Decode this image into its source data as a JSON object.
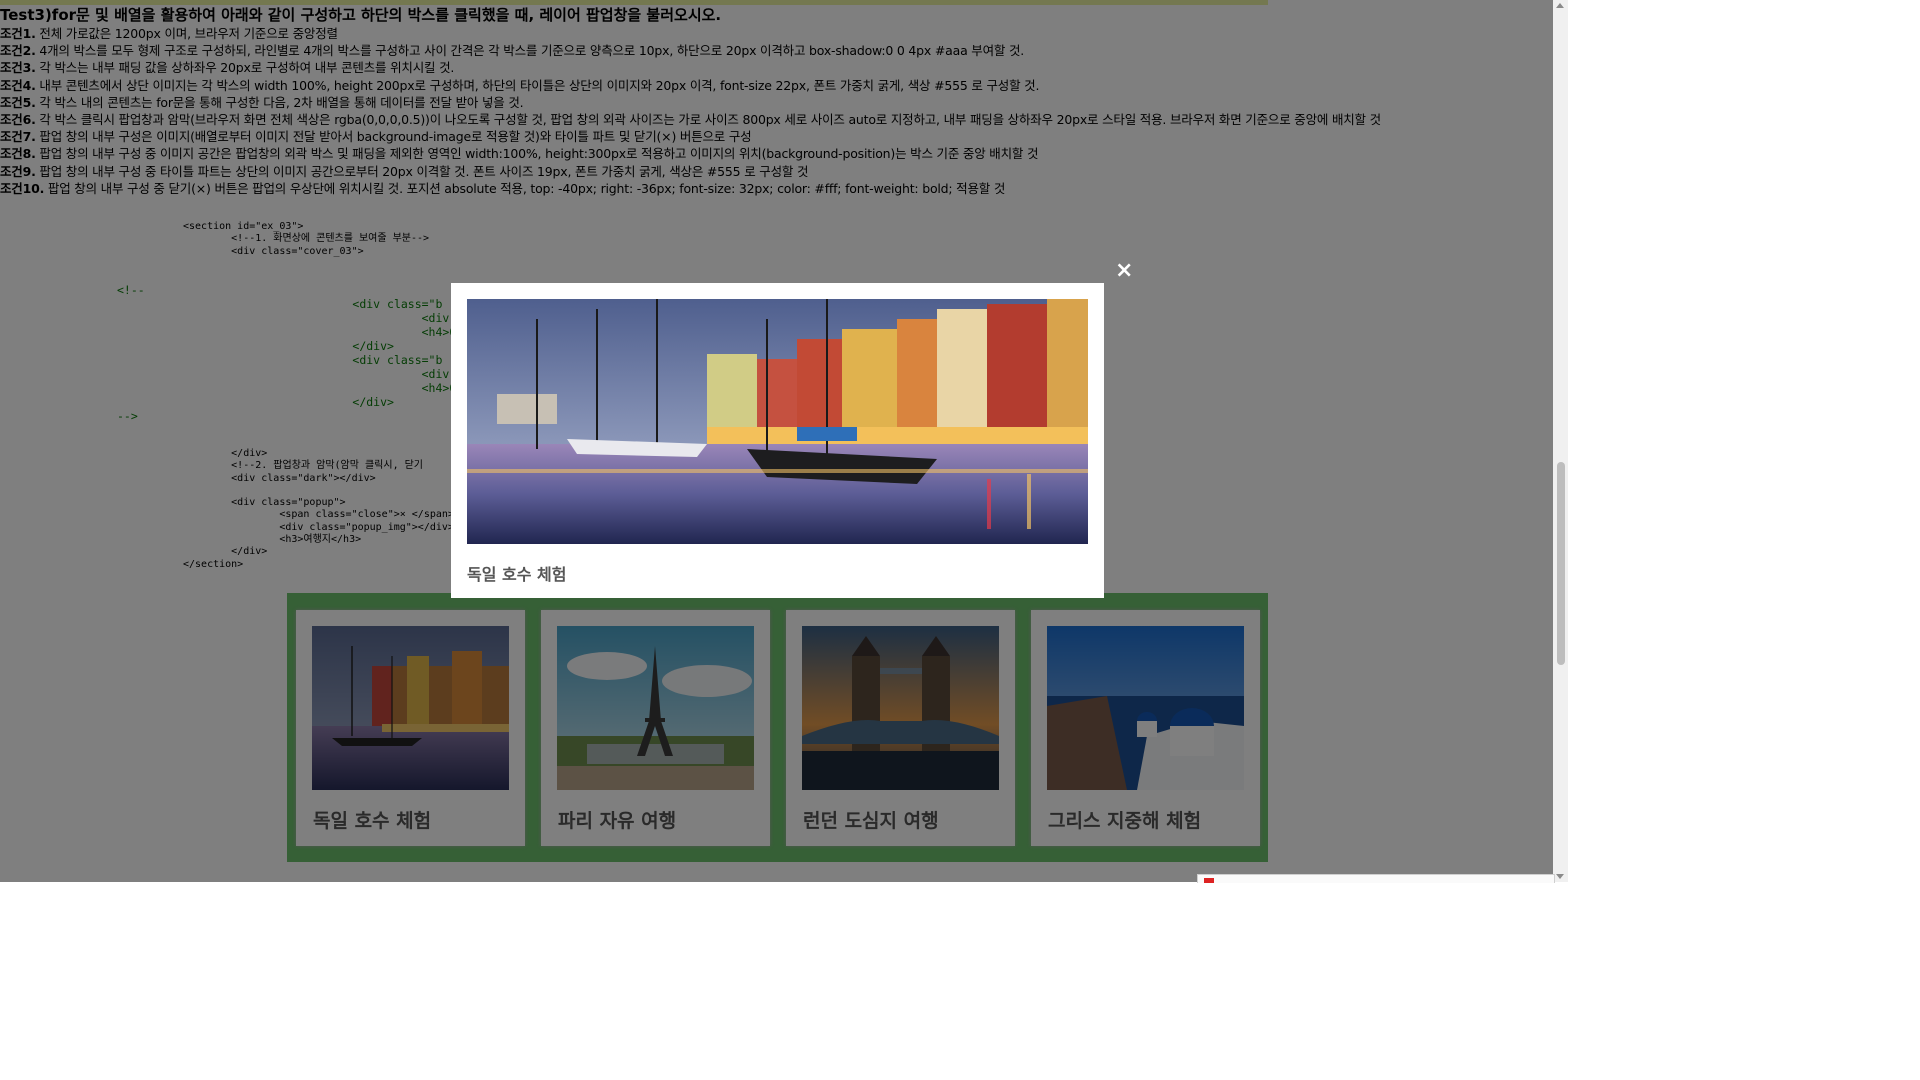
{
  "title": "Test3)for문 및 배열을 활용하여 아래와 같이 구성하고 하단의 박스를 클릭했을 때, 레이어 팝업창을 불러오시오.",
  "conditions": [
    {
      "label": "조건1.",
      "text": " 전체 가로값은 1200px 이며, 브라우저 기준으로 중앙정렬"
    },
    {
      "label": "조건2.",
      "text": " 4개의 박스를 모두 형제 구조로 구성하되, 라인별로 4개의 박스를 구성하고 사이 간격은 각 박스를 기준으로 양측으로 10px, 하단으로 20px 이격하고 box-shadow:0 0 4px #aaa 부여할 것."
    },
    {
      "label": "조건3.",
      "text": " 각 박스는 내부 패딩 값을 상하좌우 20px로 구성하여 내부 콘텐츠를 위치시킬 것."
    },
    {
      "label": "조건4.",
      "text": " 내부 콘텐츠에서 상단 이미지는 각 박스의 width 100%, height 200px로 구성하며, 하단의 타이틀은 상단의 이미지와 20px 이격, font-size 22px, 폰트 가중치 굵게, 색상 #555 로 구성할 것."
    },
    {
      "label": "조건5.",
      "text": " 각 박스 내의 콘텐츠는 for문을 통해 구성한 다음, 2차 배열을 통해 데이터를 전달 받아 넣을 것."
    },
    {
      "label": "조건6.",
      "text": " 각 박스 클릭시 팝업창과 암막(브라우저 화면 전체 색상은 rgba(0,0,0,0.5))이 나오도록 구성할 것, 팝업 창의 외곽 사이즈는 가로 사이즈 800px 세로 사이즈 auto로 지정하고, 내부 패딩을 상하좌우 20px로 스타일 적용. 브라우저 화면 기준으로 중앙에 배치할 것"
    },
    {
      "label": "조건7.",
      "text": " 팝업 창의 내부 구성은 이미지(배열로부터 이미지 전달 받아서 background-image로 적용할 것)와 타이틀 파트 및 닫기(×) 버튼으로 구성"
    },
    {
      "label": "조건8.",
      "text": " 팝업 창의 내부 구성 중 이미지 공간은 팝업창의 외곽 박스 및 패딩을 제외한 영역인 width:100%, height:300px로 적용하고 이미지의 위치(background-position)는 박스 기준 중앙 배치할 것"
    },
    {
      "label": "조건9.",
      "text": " 팝업 창의 내부 구성 중 타이틀 파트는 상단의 이미지 공간으로부터 20px 이격할 것. 폰트 사이즈 19px, 폰트 가중치 굵게, 색상은 #555 로 구성할 것"
    },
    {
      "label": "조건10.",
      "text": " 팝업 창의 내부 구성 중 닫기(×) 버튼은 팝업의 우상단에 위치시킬 것. 포지션 absolute 적용, top: -40px; right: -36px; font-size: 32px; color: #fff; font-weight: bold; 적용할 것"
    }
  ],
  "code": {
    "block1": "<section id=\"ex_03\">\n        <!--1. 화면상에 콘텐츠를 보여줄 부분-->\n        <div class=\"cover_03\">",
    "block2": "<!--\n                                  <div class=\"b\n                                            <div c\n                                            <h4>0\n                                  </div>\n                                  <div class=\"b\n                                            <div c\n                                            <h4>0\n                                  </div>\n-->",
    "block3": "        </div>\n        <!--2. 팝업창과 암막(암막 클릭시, 닫기\n        <div class=\"dark\"></div>\n\n        <div class=\"popup\">\n                <span class=\"close\">× </span>\n                <div class=\"popup_img\"></div>\n                <h3>여행지</h3>\n        </div>\n</section>"
  },
  "cards": [
    {
      "label": "독일 호수 체험",
      "image": "harbor-canal-photo"
    },
    {
      "label": "파리 자유 여행",
      "image": "eiffel-tower-photo"
    },
    {
      "label": "런던 도심지 여행",
      "image": "tower-bridge-photo"
    },
    {
      "label": "그리스 지중해 체험",
      "image": "santorini-photo"
    }
  ],
  "popup": {
    "title": "독일 호수 체험",
    "image": "harbor-canal-photo",
    "close_label": "×"
  },
  "colors": {
    "box_background": "#6cc06c",
    "title_color": "#555555",
    "overlay": "rgba(0,0,0,0.5)"
  }
}
